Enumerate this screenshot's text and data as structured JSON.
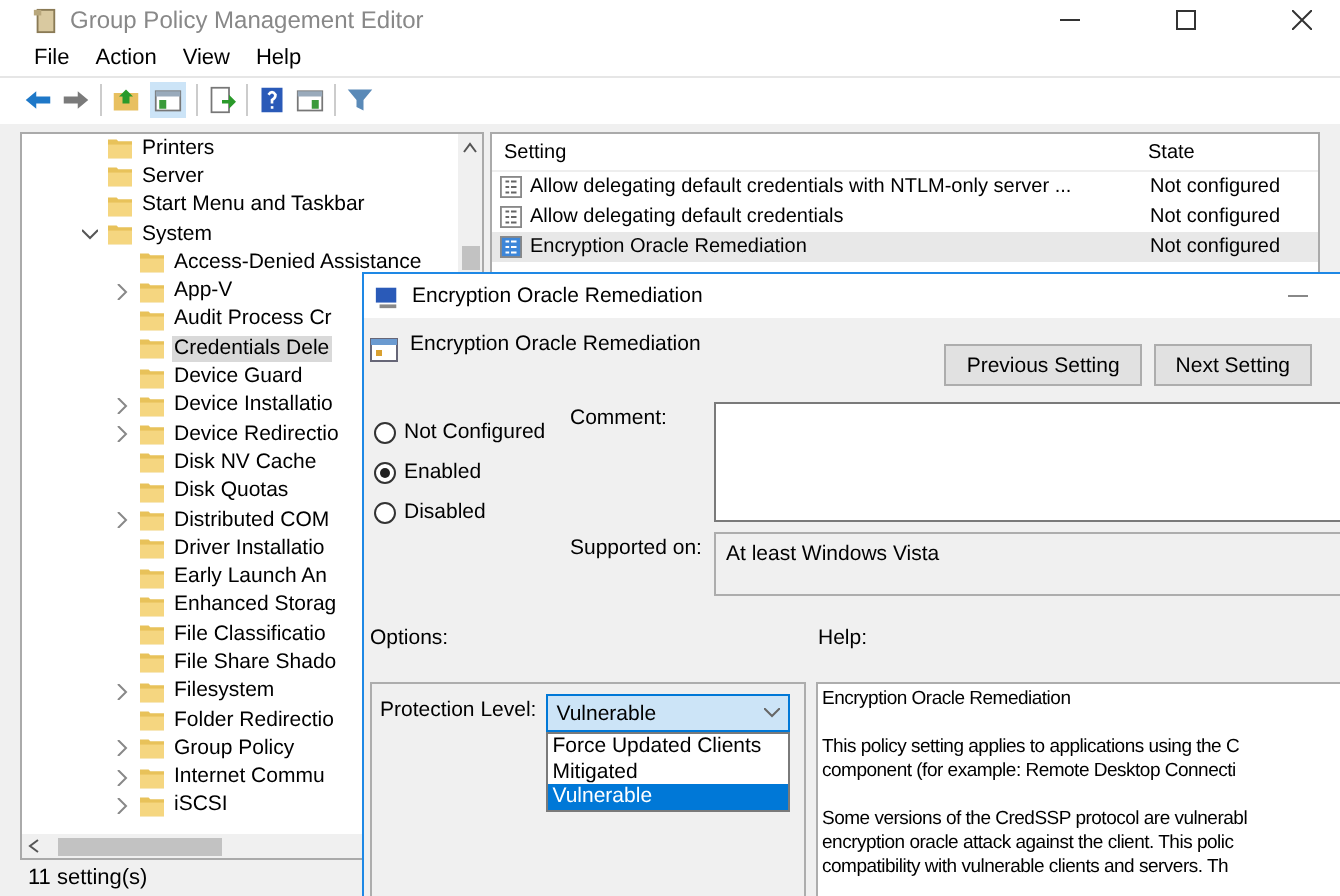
{
  "window": {
    "title": "Group Policy Management Editor"
  },
  "menu": [
    "File",
    "Action",
    "View",
    "Help"
  ],
  "toolbar": {
    "console_tree_shown": true
  },
  "tree": [
    {
      "label": "Printers",
      "kind": "leaf",
      "selected": false
    },
    {
      "label": "Server",
      "kind": "leaf",
      "selected": false
    },
    {
      "label": "Start Menu and Taskbar",
      "kind": "leaf",
      "selected": false
    },
    {
      "label": "System",
      "kind": "branch",
      "expanded": true,
      "selected": false,
      "children": [
        {
          "label": "Access-Denied Assistance",
          "kind": "leaf",
          "selected": false
        },
        {
          "label": "App-V",
          "kind": "branch",
          "expanded": false,
          "selected": false
        },
        {
          "label": "Audit Process Cr",
          "kind": "leaf",
          "selected": false
        },
        {
          "label": "Credentials Dele",
          "kind": "leaf",
          "selected": true
        },
        {
          "label": "Device Guard",
          "kind": "leaf",
          "selected": false
        },
        {
          "label": "Device Installatio",
          "kind": "branch",
          "expanded": false,
          "selected": false
        },
        {
          "label": "Device Redirectio",
          "kind": "branch",
          "expanded": false,
          "selected": false
        },
        {
          "label": "Disk NV Cache",
          "kind": "leaf",
          "selected": false
        },
        {
          "label": "Disk Quotas",
          "kind": "leaf",
          "selected": false
        },
        {
          "label": "Distributed COM",
          "kind": "branch",
          "expanded": false,
          "selected": false
        },
        {
          "label": "Driver Installatio",
          "kind": "leaf",
          "selected": false
        },
        {
          "label": "Early Launch An",
          "kind": "leaf",
          "selected": false
        },
        {
          "label": "Enhanced Storag",
          "kind": "leaf",
          "selected": false
        },
        {
          "label": "File Classificatio",
          "kind": "leaf",
          "selected": false
        },
        {
          "label": "File Share Shado",
          "kind": "leaf",
          "selected": false
        },
        {
          "label": "Filesystem",
          "kind": "branch",
          "expanded": false,
          "selected": false
        },
        {
          "label": "Folder Redirectio",
          "kind": "leaf",
          "selected": false
        },
        {
          "label": "Group Policy",
          "kind": "branch",
          "expanded": false,
          "selected": false
        },
        {
          "label": "Internet Commu",
          "kind": "branch",
          "expanded": false,
          "selected": false
        },
        {
          "label": "iSCSI",
          "kind": "branch",
          "expanded": false,
          "selected": false
        }
      ]
    }
  ],
  "settings_list": {
    "columns": [
      "Setting",
      "State"
    ],
    "rows": [
      {
        "setting": "Allow delegating default credentials with NTLM-only server ...",
        "state": "Not configured",
        "selected": false
      },
      {
        "setting": "Allow delegating default credentials",
        "state": "Not configured",
        "selected": false
      },
      {
        "setting": "Encryption Oracle Remediation",
        "state": "Not configured",
        "selected": true
      }
    ]
  },
  "status_bar": "11 setting(s)",
  "dialog": {
    "title": "Encryption Oracle Remediation",
    "heading": "Encryption Oracle Remediation",
    "buttons": [
      "Previous Setting",
      "Next Setting"
    ],
    "states": [
      {
        "label": "Not Configured",
        "selected": false
      },
      {
        "label": "Enabled",
        "selected": true
      },
      {
        "label": "Disabled",
        "selected": false
      }
    ],
    "comment_label": "Comment:",
    "supported_label": "Supported on:",
    "supported_value": "At least Windows Vista",
    "options_label": "Options:",
    "help_label": "Help:",
    "option": {
      "label": "Protection Level:",
      "value": "Vulnerable",
      "expanded": true,
      "choices": [
        {
          "label": "Force Updated Clients",
          "selected": false
        },
        {
          "label": "Mitigated",
          "selected": false
        },
        {
          "label": "Vulnerable",
          "selected": true
        }
      ]
    },
    "help": {
      "title": "Encryption Oracle Remediation",
      "paragraphs": [
        [
          "This policy setting applies to applications using the C",
          "component (for example: Remote Desktop Connecti"
        ],
        [
          "Some versions of the CredSSP protocol are vulnerabl",
          "encryption oracle attack against the client.  This polic",
          "compatibility with vulnerable clients and servers.  Th"
        ]
      ]
    }
  }
}
